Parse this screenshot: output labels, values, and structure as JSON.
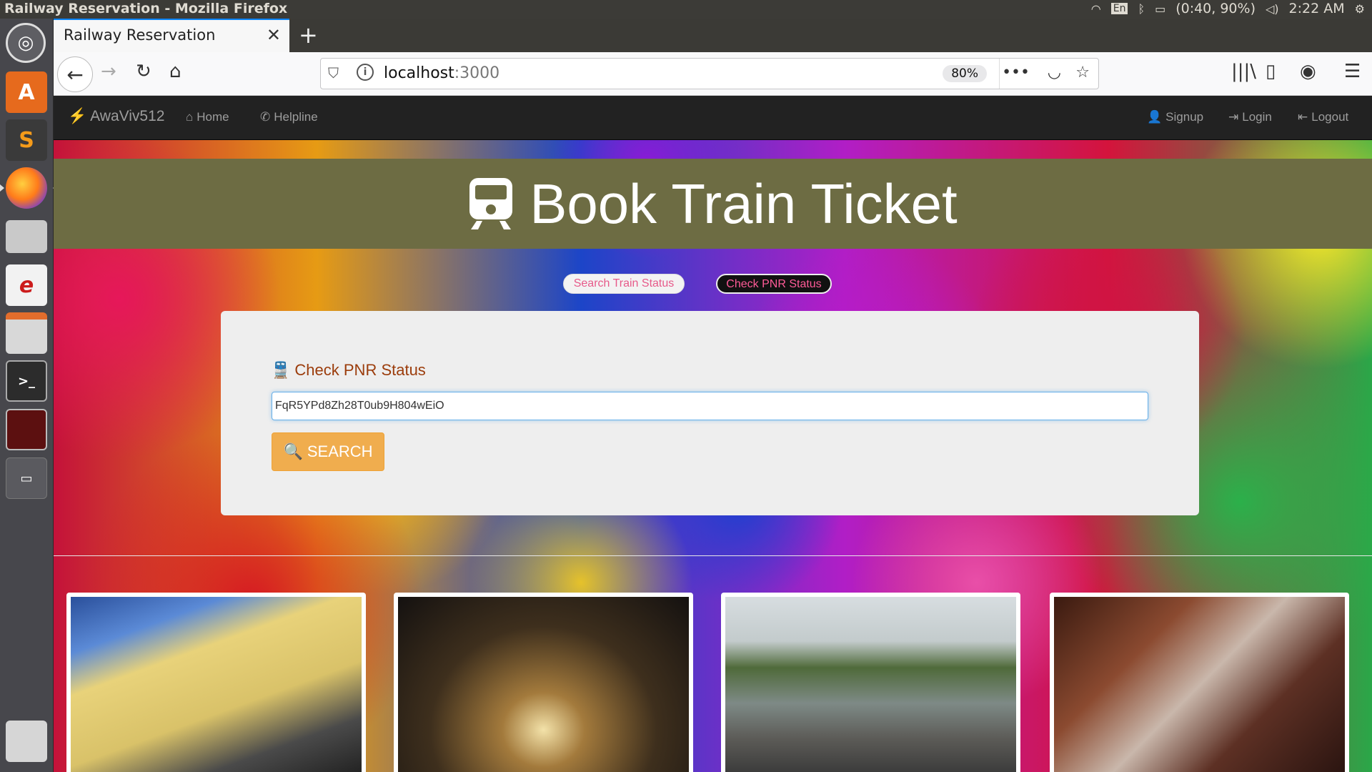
{
  "os": {
    "window_title": "Railway Reservation - Mozilla Firefox",
    "battery": "(0:40, 90%)",
    "keyboard": "En",
    "clock": "2:22 AM"
  },
  "browser": {
    "tab_title": "Railway Reservation",
    "url_host": "localhost",
    "url_port": ":3000",
    "zoom": "80%"
  },
  "site": {
    "brand": "AwaViv512",
    "nav_left": [
      {
        "label": "Home"
      },
      {
        "label": "Helpline"
      }
    ],
    "nav_right": [
      {
        "label": "Signup"
      },
      {
        "label": "Login"
      },
      {
        "label": "Logout"
      }
    ],
    "hero_title": "Book Train Ticket",
    "pills": {
      "search": "Search Train Status",
      "pnr": "Check PNR Status"
    },
    "panel": {
      "heading": "Check PNR Status",
      "pnr_value": "FqR5YPd8Zh28T0ub9H804wEiO",
      "search_label": "SEARCH"
    }
  },
  "colors": {
    "hero_bg": "#6d6c43",
    "navbar_bg": "#222222",
    "search_button": "#f0ad4e",
    "heading_color": "#9b3c0b"
  }
}
